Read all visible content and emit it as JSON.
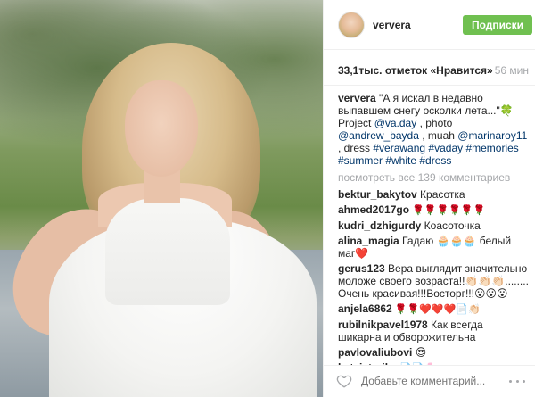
{
  "post": {
    "username": "ververa",
    "follow_label": "Подписки",
    "likes": "33,1тыс. отметок «Нравится»",
    "time": "56 мин",
    "caption": {
      "user": "ververa",
      "text_1": " \"А я искал в недавно выпавшем снегу осколки лета...\"🍀 Project ",
      "mention_1": "@va.day",
      "text_2": " , photo ",
      "mention_2": "@andrew_bayda",
      "text_3": " , muah ",
      "mention_3": "@marinaroy11",
      "text_4": " , dress ",
      "mention_4": "#verawang",
      "hashtags": "#vaday #memories #summer #white #dress"
    },
    "view_all": "посмотреть все 139 комментариев",
    "comments": [
      {
        "user": "bektur_bakytov",
        "text": " Красотка"
      },
      {
        "user": "ahmed2017go",
        "text": " 🌹🌹🌹🌹🌹🌹"
      },
      {
        "user": "kudri_dzhigurdy",
        "text": " Коасоточка"
      },
      {
        "user": "alina_magia",
        "text": " Гадаю 🧁🧁🧁 белый маг❤️"
      },
      {
        "user": "gerus123",
        "text": " Вера выглядит значительно моложе своего возраста!!👏🏻👏🏻👏🏻........ Очень красивая!!!Восторг!!!😮😮😮"
      },
      {
        "user": "anjela6862",
        "text": " 🌹🌹❤️❤️❤️📄👏🏻"
      },
      {
        "user": "rubilnikpavel1978",
        "text": " Как всегда шикарна и обворожительна"
      },
      {
        "user": "pavlovaliubovi",
        "text": " 😍"
      },
      {
        "user": "katvisterika",
        "text": " 📄📄🌸"
      }
    ],
    "add_comment_placeholder": "Добавьте комментарий..."
  },
  "icons": {
    "heart": "heart-outline-icon",
    "more": "more-horizontal-icon"
  },
  "colors": {
    "follow_green": "#70c050",
    "link_blue": "#003569",
    "muted_gray": "#a5a7aa"
  }
}
